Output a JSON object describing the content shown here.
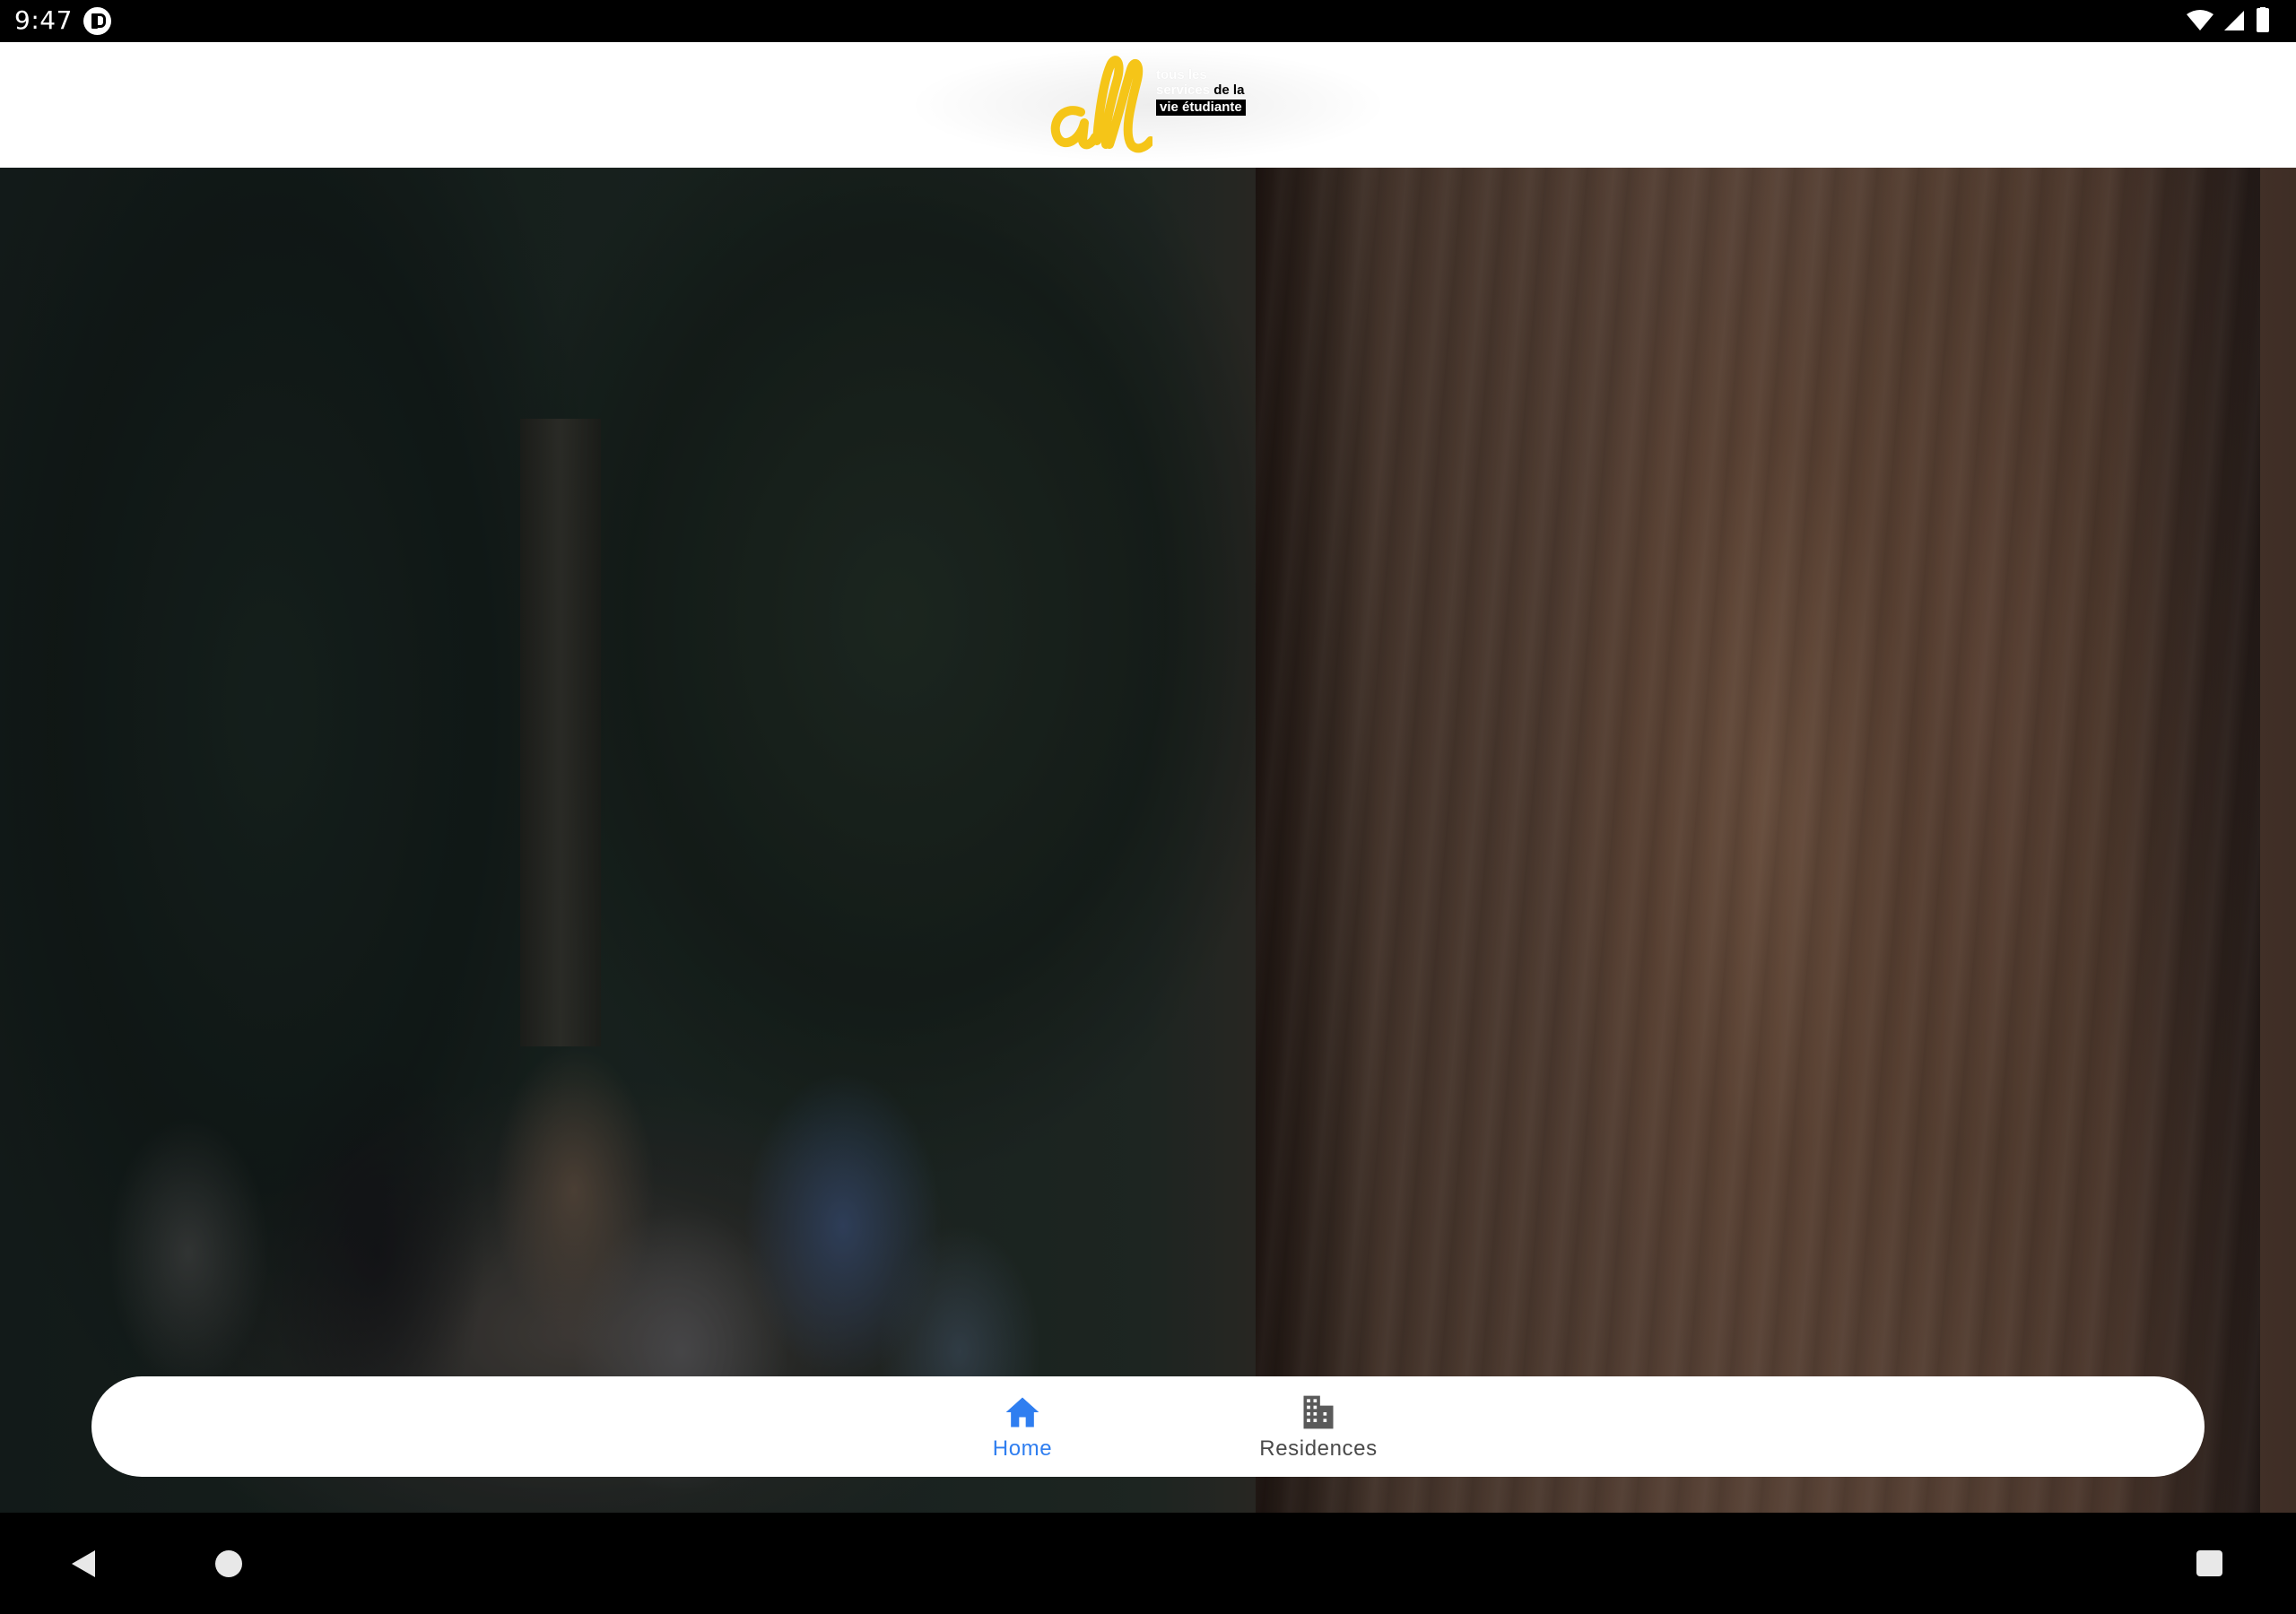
{
  "status_bar": {
    "time": "9:47"
  },
  "header": {
    "logo": {
      "wordmark": "all",
      "tagline_line1": "tous les",
      "tagline_line2_light": "services",
      "tagline_line2_dark": "de la",
      "tagline_line3": "vie étudiante"
    }
  },
  "bottom_nav": {
    "items": [
      {
        "label": "Home",
        "icon": "home-icon",
        "active": true
      },
      {
        "label": "Residences",
        "icon": "building-icon",
        "active": false
      }
    ]
  },
  "colors": {
    "accent": "#2f7ef0",
    "logo_yellow": "#f5c518",
    "inactive_nav": "#4a4a4a"
  }
}
